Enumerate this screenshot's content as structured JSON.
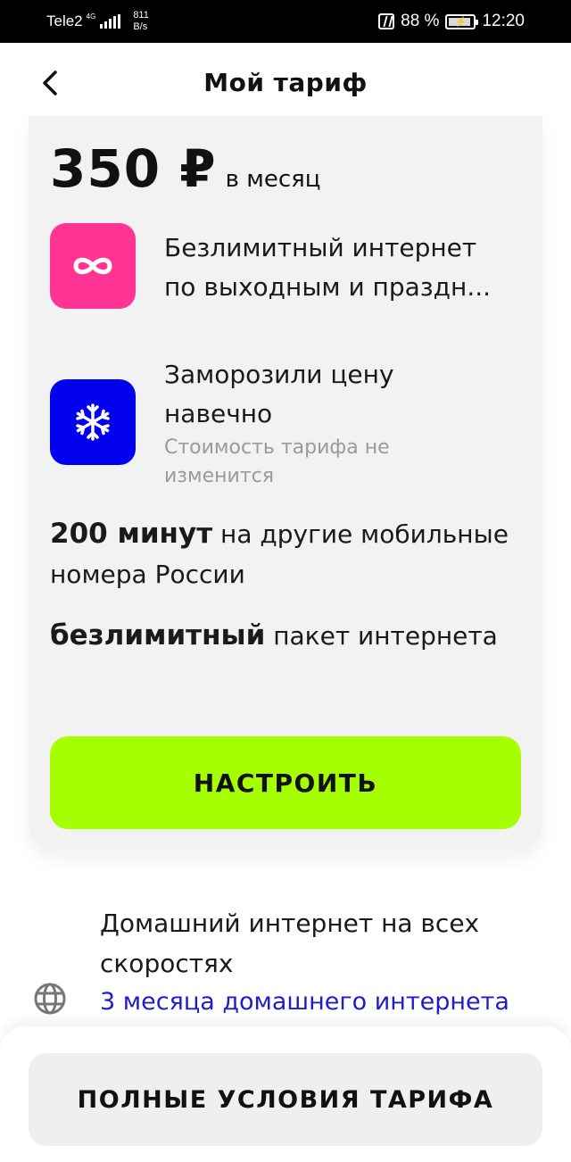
{
  "status_bar": {
    "carrier": "Tele2",
    "network": "4G",
    "speed_value": "811",
    "speed_unit": "B/s",
    "battery": "88 %",
    "time": "12:20"
  },
  "header": {
    "title": "Мой тариф"
  },
  "tariff": {
    "price": "350 ₽",
    "period": "в месяц",
    "features": [
      {
        "icon": "infinity-icon",
        "color": "#ff3495",
        "line1": "Безлимитный интернет",
        "line2": "по выходным и праздн..."
      },
      {
        "icon": "snowflake-icon",
        "color": "#0000ee",
        "line1": "Заморозили цену",
        "line2": "навечно",
        "subtitle": "Стоимость тарифа не изменится"
      }
    ],
    "minutes_bold": "200 минут",
    "minutes_rest": " на другие мобильные номера России",
    "internet_bold": "безлимитный",
    "internet_rest": " пакет интернета",
    "setup_button": "НАСТРОИТЬ",
    "accent_color": "#a6ff00"
  },
  "home_internet": {
    "title": "Домашний интернет на всех скоростях",
    "link": "3 месяца домашнего интернета",
    "link_color": "#1f1ccc",
    "icon": "globe-icon"
  },
  "bottom": {
    "terms_button": "ПОЛНЫЕ УСЛОВИЯ ТАРИФА"
  }
}
